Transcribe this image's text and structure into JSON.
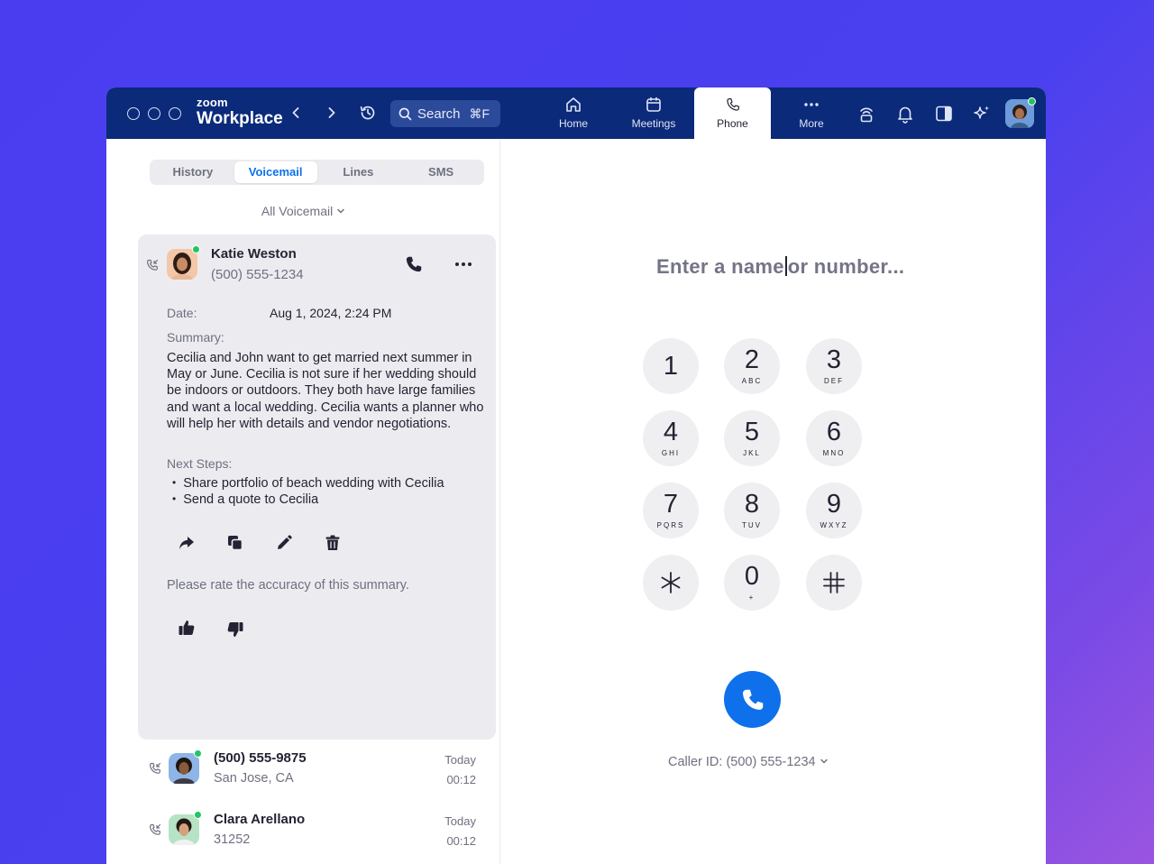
{
  "app": {
    "brand_top": "zoom",
    "brand_bottom": "Workplace"
  },
  "search": {
    "label": "Search",
    "shortcut": "⌘F"
  },
  "nav": [
    {
      "label": "Home",
      "icon": "home-icon"
    },
    {
      "label": "Meetings",
      "icon": "calendar-icon"
    },
    {
      "label": "Phone",
      "icon": "phone-icon",
      "active": true
    },
    {
      "label": "More",
      "icon": "more-icon"
    }
  ],
  "tabs": [
    "History",
    "Voicemail",
    "Lines",
    "SMS"
  ],
  "active_tab": "Voicemail",
  "filter": {
    "label": "All Voicemail"
  },
  "voicemail": {
    "name": "Katie Weston",
    "number": "(500) 555-1234",
    "date_label": "Date:",
    "date_value": "Aug 1, 2024, 2:24 PM",
    "summary_label": "Summary:",
    "summary_text": "Cecilia and John want to get married next summer in May or June. Cecilia is not sure if her wedding should be indoors or outdoors. They both have large families and want a local wedding. Cecilia wants a planner who will help her with details and vendor negotiations.",
    "next_steps_label": "Next Steps:",
    "next_steps": [
      "Share portfolio of beach wedding with Cecilia",
      "Send a quote to Cecilia"
    ],
    "rate_prompt": "Please rate the accuracy of this summary."
  },
  "history": [
    {
      "title": "(500) 555-9875",
      "subtitle": "San Jose, CA",
      "day": "Today",
      "duration": "00:12"
    },
    {
      "title": "Clara Arellano",
      "subtitle": "31252",
      "day": "Today",
      "duration": "00:12"
    }
  ],
  "dialer": {
    "placeholder_before": "Enter a name",
    "placeholder_after": "or number...",
    "keys": [
      {
        "digit": "1",
        "letters": ""
      },
      {
        "digit": "2",
        "letters": "ABC"
      },
      {
        "digit": "3",
        "letters": "DEF"
      },
      {
        "digit": "4",
        "letters": "GHI"
      },
      {
        "digit": "5",
        "letters": "JKL"
      },
      {
        "digit": "6",
        "letters": "MNO"
      },
      {
        "digit": "7",
        "letters": "PQRS"
      },
      {
        "digit": "8",
        "letters": "TUV"
      },
      {
        "digit": "9",
        "letters": "WXYZ"
      },
      {
        "digit": "*",
        "letters": ""
      },
      {
        "digit": "0",
        "letters": "+"
      },
      {
        "digit": "#",
        "letters": ""
      }
    ],
    "caller_id": "Caller ID: (500) 555-1234"
  },
  "colors": {
    "titlebar": "#0b2a7a",
    "accent": "#0e71eb",
    "online": "#22c55e",
    "card": "#ececf0"
  }
}
